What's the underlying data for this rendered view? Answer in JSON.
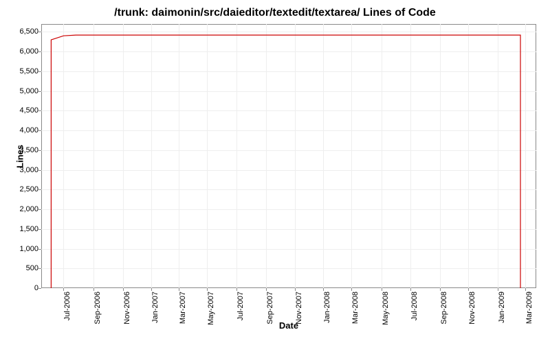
{
  "chart_data": {
    "type": "line",
    "title": "/trunk: daimonin/src/daieditor/textedit/textarea/ Lines of Code",
    "xlabel": "Date",
    "ylabel": "Lines",
    "ylim": [
      0,
      6700
    ],
    "y_ticks": [
      0,
      500,
      1000,
      1500,
      2000,
      2500,
      3000,
      3500,
      4000,
      4500,
      5000,
      5500,
      6000,
      6500
    ],
    "y_tick_labels": [
      "0",
      "500",
      "1,000",
      "1,500",
      "2,000",
      "2,500",
      "3,000",
      "3,500",
      "4,000",
      "4,500",
      "5,000",
      "5,500",
      "6,000",
      "6,500"
    ],
    "x_tick_labels": [
      "Jul-2006",
      "Sep-2006",
      "Nov-2006",
      "Jan-2007",
      "Mar-2007",
      "May-2007",
      "Jul-2007",
      "Sep-2007",
      "Nov-2007",
      "Jan-2008",
      "Mar-2008",
      "May-2008",
      "Jul-2008",
      "Sep-2008",
      "Nov-2008",
      "Jan-2009",
      "Mar-2009"
    ],
    "x_tick_positions": [
      0.045,
      0.105,
      0.165,
      0.222,
      0.278,
      0.335,
      0.394,
      0.454,
      0.512,
      0.57,
      0.627,
      0.687,
      0.746,
      0.805,
      0.863,
      0.922,
      0.978
    ],
    "series": [
      {
        "name": "Lines",
        "color": "#cc0000",
        "points": [
          {
            "x": 0.02,
            "y": 0
          },
          {
            "x": 0.02,
            "y": 6300
          },
          {
            "x": 0.045,
            "y": 6400
          },
          {
            "x": 0.07,
            "y": 6420
          },
          {
            "x": 0.968,
            "y": 6420
          },
          {
            "x": 0.968,
            "y": 0
          }
        ]
      }
    ]
  }
}
